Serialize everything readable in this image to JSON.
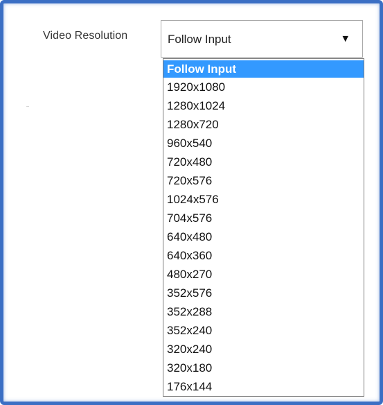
{
  "form": {
    "label": "Video Resolution",
    "selected_value": "Follow Input",
    "arrow": "▼"
  },
  "dropdown": {
    "options": [
      "Follow Input",
      "1920x1080",
      "1280x1024",
      "1280x720",
      "960x540",
      "720x480",
      "720x576",
      "1024x576",
      "704x576",
      "640x480",
      "640x360",
      "480x270",
      "352x576",
      "352x288",
      "352x240",
      "320x240",
      "320x180",
      "176x144"
    ],
    "highlighted_index": 0,
    "highlight_color": "#3399ff"
  },
  "theme": {
    "frame_border_color": "#3b6fc4"
  }
}
